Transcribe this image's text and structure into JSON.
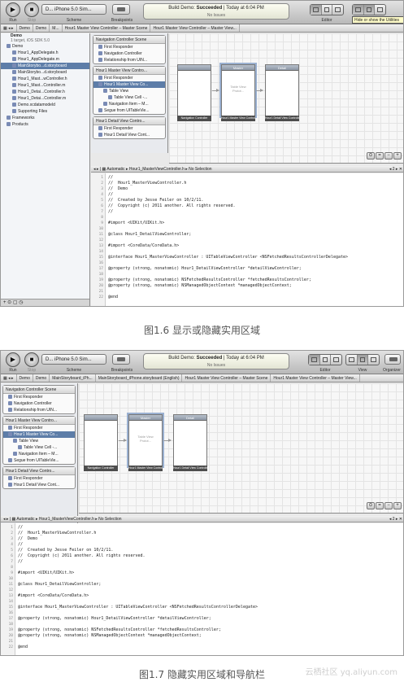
{
  "toolbar": {
    "run": "Run",
    "stop": "Stop",
    "scheme_label": "Scheme",
    "scheme_value": "D... iPhone 5.0 Sim...",
    "breakpoints": "Breakpoints",
    "build_status_prefix": "Build Demo: ",
    "build_status": "Succeeded",
    "build_time": "Today at 6:04 PM",
    "issues": "No Issues",
    "editor": "Editor",
    "view": "View",
    "organizer": "Organizer",
    "tooltip": "Hide or show the Utilities"
  },
  "jumpbar1": [
    "Demo",
    "Demo",
    "M...",
    "Hour1 Master View Controller – Master Scene",
    "Hour1 Master View Controller – Master View..."
  ],
  "jumpbar2": [
    "Demo",
    "Demo",
    "MainStoryboard_iPh...",
    "MainStoryboard_iPhone.storyboard (English)",
    "Hour1 Master View Controller – Master Scene",
    "Hour1 Master View Controller – Master View..."
  ],
  "navigator": {
    "project": "Demo",
    "project_sub": "1 target, iOS SDK 5.0",
    "items": [
      {
        "label": "Demo",
        "indent": 1
      },
      {
        "label": "Hour1_AppDelegate.h",
        "indent": 2
      },
      {
        "label": "Hour1_AppDelegate.m",
        "indent": 2
      },
      {
        "label": "MainStorybo...d.storyboard",
        "indent": 2,
        "selected": true
      },
      {
        "label": "MainStorybo...d.storyboard",
        "indent": 2
      },
      {
        "label": "Hour1_Mast...wController.h",
        "indent": 2
      },
      {
        "label": "Hour1_Mast...Controller.m",
        "indent": 2
      },
      {
        "label": "Hour1_Detai...Controller.h",
        "indent": 2
      },
      {
        "label": "Hour1_Detai...Controller.m",
        "indent": 2
      },
      {
        "label": "Demo.xcdatamodeld",
        "indent": 2
      },
      {
        "label": "Supporting Files",
        "indent": 2
      },
      {
        "label": "Frameworks",
        "indent": 1
      },
      {
        "label": "Products",
        "indent": 1
      }
    ]
  },
  "scenes": [
    {
      "title": "Navigation Controller Scene",
      "rows": [
        {
          "label": "First Responder",
          "indent": 1
        },
        {
          "label": "Navigation Controller",
          "indent": 1
        },
        {
          "label": "Relationship from UIN...",
          "indent": 1
        }
      ]
    },
    {
      "title": "Hour1 Master View Contro...",
      "rows": [
        {
          "label": "First Responder",
          "indent": 1
        },
        {
          "label": "Hour1 Master View Co...",
          "indent": 1,
          "selected": true
        },
        {
          "label": "Table View",
          "indent": 2
        },
        {
          "label": "Table View Cell -...",
          "indent": 3
        },
        {
          "label": "Navigation Item – M...",
          "indent": 2
        },
        {
          "label": "Segue from UITableVie...",
          "indent": 1
        }
      ]
    },
    {
      "title": "Hour1 Detail View Contro...",
      "rows": [
        {
          "label": "First Responder",
          "indent": 1
        },
        {
          "label": "Hour1 Detail View Cont...",
          "indent": 1
        }
      ]
    }
  ],
  "canvas": {
    "phones": [
      {
        "caption": "Navigation Controller",
        "bar": ""
      },
      {
        "caption": "Hour1 Master View Controller – Master",
        "bar": "Master",
        "body": "Table View\nProtot..."
      },
      {
        "caption": "Hour1 Detail View Controller",
        "bar": "Detail"
      }
    ]
  },
  "editor_bar": {
    "automatic": "Automatic",
    "file": "Hour1_MasterViewController.h",
    "selection": "No Selection",
    "counter": "2"
  },
  "code": [
    "//",
    "//  Hour1_MasterViewController.h",
    "//  Demo",
    "//",
    "//  Created by Jesse Feiler on 10/2/11.",
    "//  Copyright (c) 2011 another. All rights reserved.",
    "//",
    "",
    "#import <UIKit/UIKit.h>",
    "",
    "@class Hour1_DetailViewController;",
    "",
    "#import <CoreData/CoreData.h>",
    "",
    "@interface Hour1_MasterViewController : UITableViewController <NSFetchedResultsControllerDelegate>",
    "",
    "@property (strong, nonatomic) Hour1_DetailViewController *detailViewController;",
    "",
    "@property (strong, nonatomic) NSFetchedResultsController *fetchedResultsController;",
    "@property (strong, nonatomic) NSManagedObjectContext *managedObjectContext;",
    "",
    "@end"
  ],
  "captions": {
    "fig1": "图1.6 显示或隐藏实用区域",
    "fig2": "图1.7 隐藏实用区域和导航栏"
  },
  "watermark": "云栖社区 yq.aliyun.com"
}
